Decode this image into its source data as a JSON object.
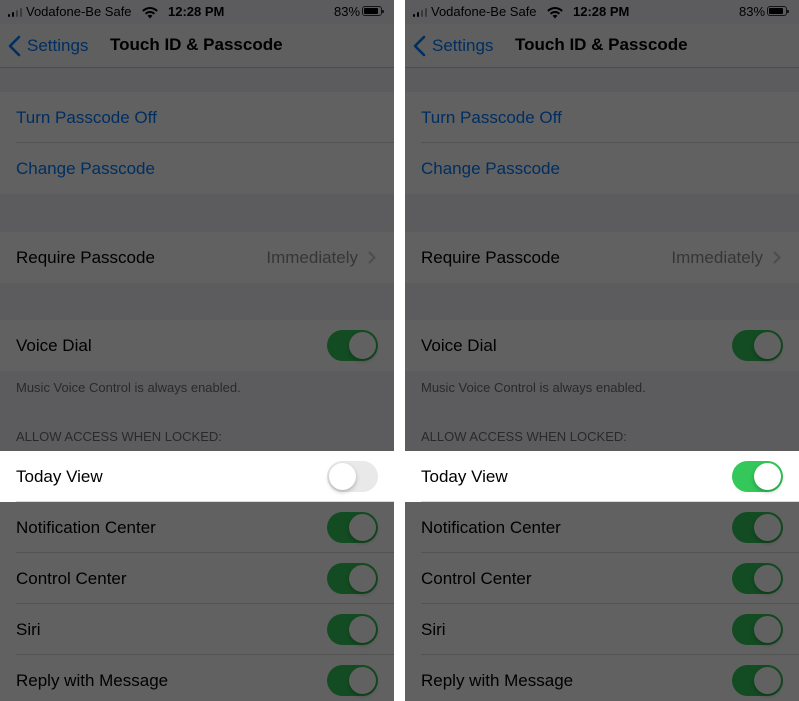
{
  "status_bar": {
    "carrier": "Vodafone-Be Safe",
    "time": "12:28 PM",
    "battery": "83%"
  },
  "nav": {
    "back_label": "Settings",
    "title": "Touch ID & Passcode"
  },
  "passcode": {
    "turn_off": "Turn Passcode Off",
    "change": "Change Passcode"
  },
  "require": {
    "label": "Require Passcode",
    "value": "Immediately"
  },
  "voice_dial": {
    "label": "Voice Dial",
    "footnote": "Music Voice Control is always enabled."
  },
  "allow_access_header": "ALLOW ACCESS WHEN LOCKED:",
  "locked_items": {
    "today_view": "Today View",
    "notification_center": "Notification Center",
    "control_center": "Control Center",
    "siri": "Siri",
    "reply_with_message": "Reply with Message"
  },
  "toggle_states": {
    "left": {
      "voice_dial": true,
      "today_view": false,
      "notification_center": true,
      "control_center": true,
      "siri": true,
      "reply_with_message": true
    },
    "right": {
      "voice_dial": true,
      "today_view": true,
      "notification_center": true,
      "control_center": true,
      "siri": true,
      "reply_with_message": true
    }
  },
  "colors": {
    "accent": "#007aff",
    "toggle_on": "#34c759",
    "toggle_off": "#e9e9ea",
    "background": "#f2f2f7"
  },
  "icons": [
    "cellular-signal-icon",
    "wifi-icon",
    "battery-icon",
    "chevron-left-icon",
    "chevron-right-icon"
  ]
}
